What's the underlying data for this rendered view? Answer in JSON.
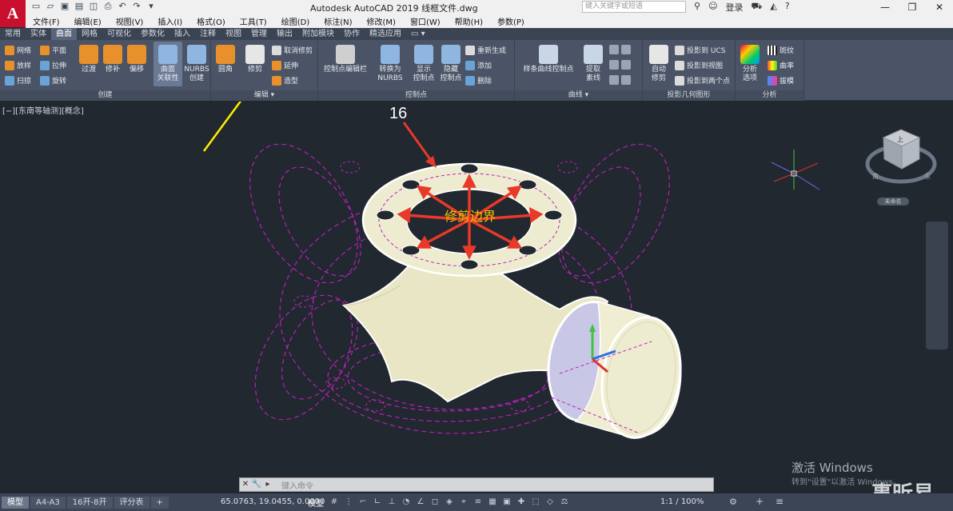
{
  "app": {
    "logo": "A",
    "title": "Autodesk AutoCAD 2019    线框文件.dwg",
    "search_placeholder": "键入关键字或短语",
    "login": "登录",
    "window_buttons": [
      "—",
      "❐",
      "✕"
    ]
  },
  "menu": [
    "文件(F)",
    "编辑(E)",
    "视图(V)",
    "插入(I)",
    "格式(O)",
    "工具(T)",
    "绘图(D)",
    "标注(N)",
    "修改(M)",
    "窗口(W)",
    "帮助(H)",
    "参数(P)"
  ],
  "ribbon_tabs": [
    "常用",
    "实体",
    "曲面",
    "网格",
    "可视化",
    "参数化",
    "插入",
    "注释",
    "视图",
    "管理",
    "输出",
    "附加模块",
    "协作",
    "精选应用"
  ],
  "active_tab": "曲面",
  "ribbon": {
    "create": {
      "title": "创建",
      "small": [
        "网络",
        "平面",
        "放样",
        "拉伸",
        "扫掠",
        "旋转"
      ],
      "big": [
        "过渡",
        "修补",
        "偏移",
        "曲面\n关联性",
        "NURBS\n创建"
      ]
    },
    "edit": {
      "title": "编辑",
      "big": [
        "圆角",
        "修剪"
      ],
      "small": [
        "取消修剪",
        "延伸",
        "造型"
      ]
    },
    "cv": {
      "title": "控制点",
      "big": [
        "控制点编辑栏",
        "转换为\nNURBS",
        "显示\n控制点",
        "隐藏\n控制点"
      ],
      "small": [
        "重新生成",
        "添加",
        "删除"
      ]
    },
    "curves": {
      "title": "曲线",
      "big": [
        "样条曲线控制点",
        "提取\n素线"
      ]
    },
    "project": {
      "title": "投影几何图形",
      "big": [
        "自动\n修剪"
      ],
      "small": [
        "投影到 UCS",
        "投影到视图",
        "投影到两个点"
      ]
    },
    "analysis": {
      "title": "分析",
      "big": [
        "分析\n选项"
      ],
      "small": [
        "斑纹",
        "曲率",
        "拔模"
      ]
    }
  },
  "viewport": {
    "label": "[−][东南等轴测][概念]",
    "annotation_number": "16",
    "trim_label": "修剪边界",
    "viewcube_label": "未命名",
    "viewcube_top": "上",
    "viewcube_south": "南",
    "viewcube_east": "东",
    "watermark_line1": "激活 Windows",
    "watermark_line2": "转到\"设置\"以激活 Windows。",
    "watermark_brand": "事昕易"
  },
  "command": {
    "placeholder": "键入命令"
  },
  "status": {
    "layout_tabs": [
      "模型",
      "A4-A3",
      "16开-8开",
      "评分表",
      "+"
    ],
    "active_layout": "模型",
    "coords": "65.0763, 19.0455, 0.0000",
    "model": "模型",
    "scale": "1:1 / 100%"
  },
  "colors": {
    "viewport_bg": "#212830",
    "ribbon_bg": "#4a5466",
    "wire": "#c020c0",
    "arrow_red": "#e8392a",
    "arrow_yellow": "#ffef00",
    "trim_label": "#f2c200"
  }
}
